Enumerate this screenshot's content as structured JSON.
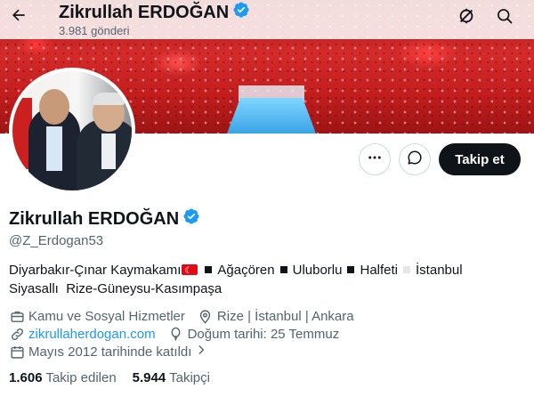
{
  "header": {
    "name": "Zikrullah ERDOĞAN",
    "post_count": "3.981 gönderi"
  },
  "profile": {
    "name": "Zikrullah ERDOĞAN",
    "handle": "@Z_Erdogan53",
    "follow_label": "Takip et",
    "bio": {
      "part1": "Diyarbakır-Çınar Kaymakamı",
      "items": [
        "Ağaçören",
        "Uluborlu",
        "Halfeti",
        "İstanbul"
      ],
      "line2": "Siyasallı  Rize-Güneysu-Kasımpaşa"
    },
    "meta": {
      "category": "Kamu ve Sosyal Hizmetler",
      "location": "Rize | İstanbul | Ankara",
      "website": "zikrullaherdogan.com",
      "birthday": "Doğum tarihi: 25 Temmuz",
      "joined": "Mayıs 2012 tarihinde katıldı"
    },
    "stats": {
      "following_count": "1.606",
      "following_label": "Takip edilen",
      "followers_count": "5.944",
      "followers_label": "Takipçi"
    }
  },
  "colors": {
    "accent": "#1d9bf0",
    "text": "#0f1419",
    "muted": "#536471",
    "verified": "#1d9bf0"
  },
  "icons": [
    "back-arrow-icon",
    "verified-badge-icon",
    "notifications-off-icon",
    "search-icon",
    "more-icon",
    "message-icon",
    "briefcase-icon",
    "location-icon",
    "link-icon",
    "balloon-icon",
    "calendar-icon",
    "chevron-right-icon"
  ]
}
